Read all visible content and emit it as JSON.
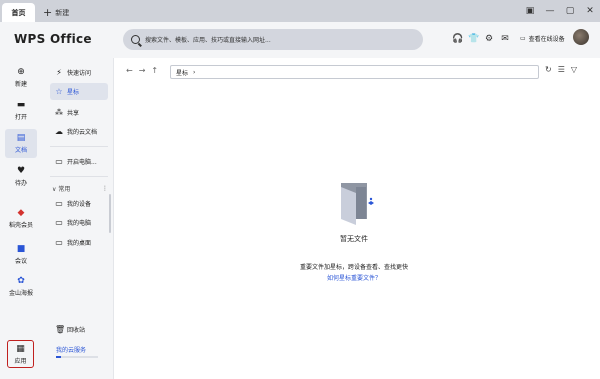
{
  "tabs": {
    "home": "首页",
    "new": "新建"
  },
  "header": {
    "logo": "WPS Office",
    "search_placeholder": "搜索文件、模板、应用、技巧或直接输入网址...",
    "login_label": "查看在线设备"
  },
  "leftnav": [
    {
      "key": "new",
      "label": "新建",
      "icon": "plus-icon"
    },
    {
      "key": "open",
      "label": "打开",
      "icon": "folder-icon"
    },
    {
      "key": "docs",
      "label": "文档",
      "icon": "document-icon",
      "active": true
    },
    {
      "key": "todo",
      "label": "待办",
      "icon": "heart-check-icon"
    },
    {
      "key": "vip",
      "label": "稻壳会员",
      "icon": "vip-icon"
    },
    {
      "key": "meeting",
      "label": "会议",
      "icon": "video-icon"
    },
    {
      "key": "kingsoft",
      "label": "金山海报",
      "icon": "poster-icon"
    },
    {
      "key": "apps",
      "label": "应用",
      "icon": "grid-icon"
    }
  ],
  "sidecol": {
    "items": [
      {
        "label": "快速访问",
        "icon": "flash-icon"
      },
      {
        "label": "星标",
        "icon": "star-icon",
        "active": true
      },
      {
        "label": "共享",
        "icon": "share-icon"
      },
      {
        "label": "我的云文档",
        "icon": "cloud-icon"
      }
    ],
    "open_label": "开启电脑...",
    "group_label": "常用",
    "devices": [
      {
        "label": "我的设备",
        "icon": "devices-icon"
      },
      {
        "label": "我的电脑",
        "icon": "computer-icon"
      },
      {
        "label": "我的桌面",
        "icon": "desktop-icon"
      }
    ],
    "recycle_label": "回收站",
    "cloud_label": "我的云服务",
    "cloud_usage": 0.12
  },
  "main": {
    "path_label": "星标",
    "empty_title": "暂无文件",
    "empty_desc": "重要文件加星标，跨设备查看、查找更快",
    "empty_link": "如何星标重要文件？"
  }
}
